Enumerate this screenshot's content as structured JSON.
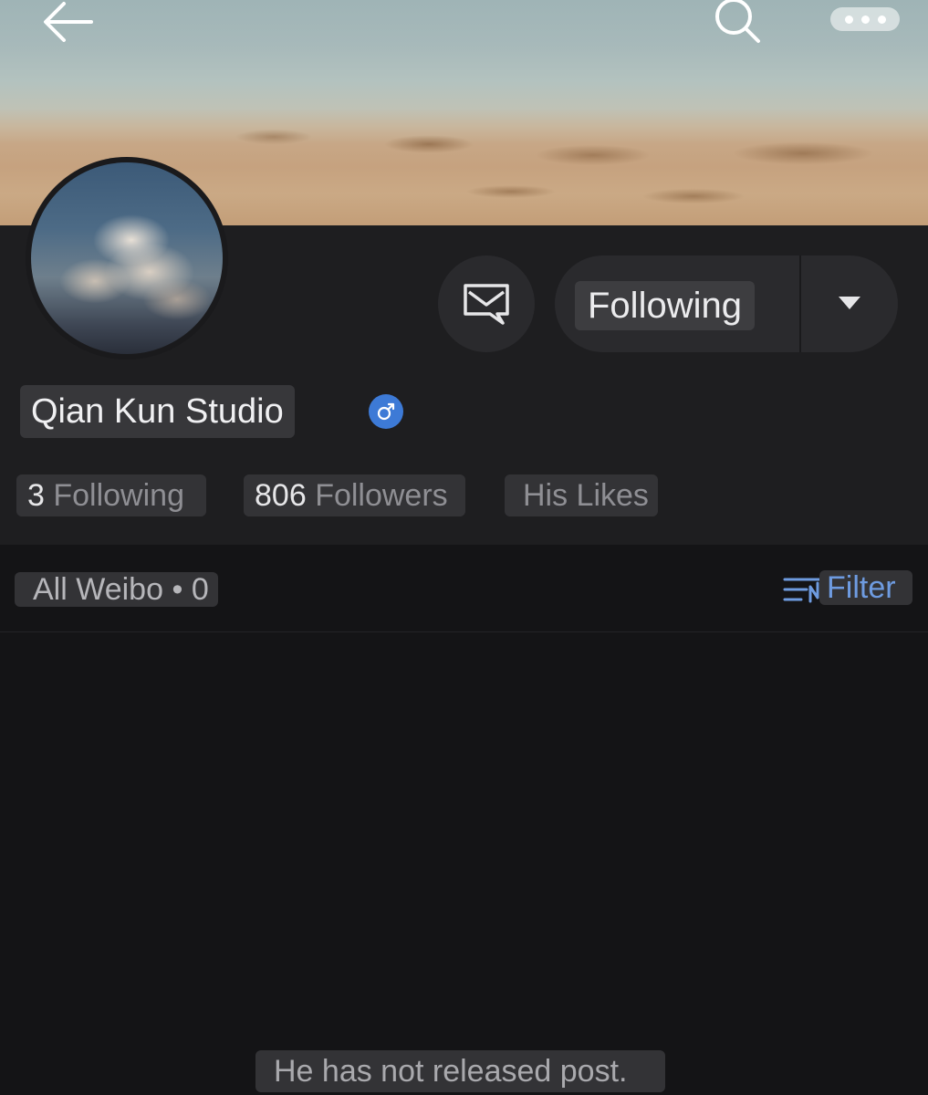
{
  "nav": {
    "back_icon": "back-arrow-icon",
    "search_icon": "search-icon",
    "more_icon": "more-options-icon"
  },
  "profile": {
    "name": "Qian Kun Studio",
    "gender_icon": "male-symbol-icon",
    "gender_color": "#3d7ad6",
    "message_icon": "message-icon",
    "follow_state_label": "Following",
    "dropdown_icon": "dropdown-arrow-icon"
  },
  "stats": {
    "following_count": "3",
    "following_label": "Following",
    "followers_count": "806",
    "followers_label": "Followers",
    "likes_label": "His Likes"
  },
  "feed_tabs": {
    "all_label": "All Weibo",
    "separator": "•",
    "count": "0",
    "filter_icon": "filter-sort-icon",
    "filter_label": "Filter",
    "accent_color": "#6e9be0"
  },
  "empty_state": {
    "message": "He has not released post."
  }
}
